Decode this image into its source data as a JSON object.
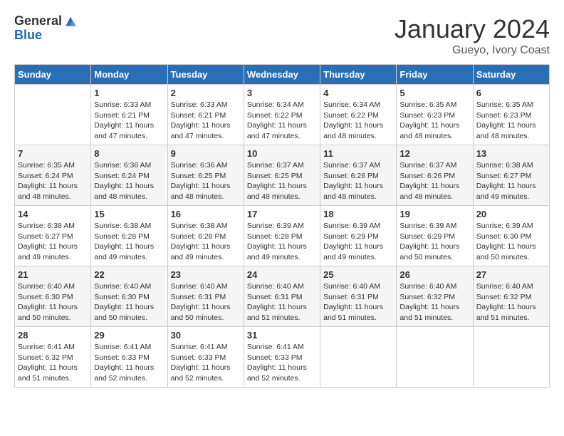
{
  "logo": {
    "general": "General",
    "blue": "Blue"
  },
  "title": {
    "month_year": "January 2024",
    "location": "Gueyo, Ivory Coast"
  },
  "days_of_week": [
    "Sunday",
    "Monday",
    "Tuesday",
    "Wednesday",
    "Thursday",
    "Friday",
    "Saturday"
  ],
  "weeks": [
    [
      {
        "day": "",
        "sunrise": "",
        "sunset": "",
        "daylight": ""
      },
      {
        "day": "1",
        "sunrise": "Sunrise: 6:33 AM",
        "sunset": "Sunset: 6:21 PM",
        "daylight": "Daylight: 11 hours and 47 minutes."
      },
      {
        "day": "2",
        "sunrise": "Sunrise: 6:33 AM",
        "sunset": "Sunset: 6:21 PM",
        "daylight": "Daylight: 11 hours and 47 minutes."
      },
      {
        "day": "3",
        "sunrise": "Sunrise: 6:34 AM",
        "sunset": "Sunset: 6:22 PM",
        "daylight": "Daylight: 11 hours and 47 minutes."
      },
      {
        "day": "4",
        "sunrise": "Sunrise: 6:34 AM",
        "sunset": "Sunset: 6:22 PM",
        "daylight": "Daylight: 11 hours and 48 minutes."
      },
      {
        "day": "5",
        "sunrise": "Sunrise: 6:35 AM",
        "sunset": "Sunset: 6:23 PM",
        "daylight": "Daylight: 11 hours and 48 minutes."
      },
      {
        "day": "6",
        "sunrise": "Sunrise: 6:35 AM",
        "sunset": "Sunset: 6:23 PM",
        "daylight": "Daylight: 11 hours and 48 minutes."
      }
    ],
    [
      {
        "day": "7",
        "sunrise": "Sunrise: 6:35 AM",
        "sunset": "Sunset: 6:24 PM",
        "daylight": "Daylight: 11 hours and 48 minutes."
      },
      {
        "day": "8",
        "sunrise": "Sunrise: 6:36 AM",
        "sunset": "Sunset: 6:24 PM",
        "daylight": "Daylight: 11 hours and 48 minutes."
      },
      {
        "day": "9",
        "sunrise": "Sunrise: 6:36 AM",
        "sunset": "Sunset: 6:25 PM",
        "daylight": "Daylight: 11 hours and 48 minutes."
      },
      {
        "day": "10",
        "sunrise": "Sunrise: 6:37 AM",
        "sunset": "Sunset: 6:25 PM",
        "daylight": "Daylight: 11 hours and 48 minutes."
      },
      {
        "day": "11",
        "sunrise": "Sunrise: 6:37 AM",
        "sunset": "Sunset: 6:26 PM",
        "daylight": "Daylight: 11 hours and 48 minutes."
      },
      {
        "day": "12",
        "sunrise": "Sunrise: 6:37 AM",
        "sunset": "Sunset: 6:26 PM",
        "daylight": "Daylight: 11 hours and 48 minutes."
      },
      {
        "day": "13",
        "sunrise": "Sunrise: 6:38 AM",
        "sunset": "Sunset: 6:27 PM",
        "daylight": "Daylight: 11 hours and 49 minutes."
      }
    ],
    [
      {
        "day": "14",
        "sunrise": "Sunrise: 6:38 AM",
        "sunset": "Sunset: 6:27 PM",
        "daylight": "Daylight: 11 hours and 49 minutes."
      },
      {
        "day": "15",
        "sunrise": "Sunrise: 6:38 AM",
        "sunset": "Sunset: 6:28 PM",
        "daylight": "Daylight: 11 hours and 49 minutes."
      },
      {
        "day": "16",
        "sunrise": "Sunrise: 6:38 AM",
        "sunset": "Sunset: 6:28 PM",
        "daylight": "Daylight: 11 hours and 49 minutes."
      },
      {
        "day": "17",
        "sunrise": "Sunrise: 6:39 AM",
        "sunset": "Sunset: 6:28 PM",
        "daylight": "Daylight: 11 hours and 49 minutes."
      },
      {
        "day": "18",
        "sunrise": "Sunrise: 6:39 AM",
        "sunset": "Sunset: 6:29 PM",
        "daylight": "Daylight: 11 hours and 49 minutes."
      },
      {
        "day": "19",
        "sunrise": "Sunrise: 6:39 AM",
        "sunset": "Sunset: 6:29 PM",
        "daylight": "Daylight: 11 hours and 50 minutes."
      },
      {
        "day": "20",
        "sunrise": "Sunrise: 6:39 AM",
        "sunset": "Sunset: 6:30 PM",
        "daylight": "Daylight: 11 hours and 50 minutes."
      }
    ],
    [
      {
        "day": "21",
        "sunrise": "Sunrise: 6:40 AM",
        "sunset": "Sunset: 6:30 PM",
        "daylight": "Daylight: 11 hours and 50 minutes."
      },
      {
        "day": "22",
        "sunrise": "Sunrise: 6:40 AM",
        "sunset": "Sunset: 6:30 PM",
        "daylight": "Daylight: 11 hours and 50 minutes."
      },
      {
        "day": "23",
        "sunrise": "Sunrise: 6:40 AM",
        "sunset": "Sunset: 6:31 PM",
        "daylight": "Daylight: 11 hours and 50 minutes."
      },
      {
        "day": "24",
        "sunrise": "Sunrise: 6:40 AM",
        "sunset": "Sunset: 6:31 PM",
        "daylight": "Daylight: 11 hours and 51 minutes."
      },
      {
        "day": "25",
        "sunrise": "Sunrise: 6:40 AM",
        "sunset": "Sunset: 6:31 PM",
        "daylight": "Daylight: 11 hours and 51 minutes."
      },
      {
        "day": "26",
        "sunrise": "Sunrise: 6:40 AM",
        "sunset": "Sunset: 6:32 PM",
        "daylight": "Daylight: 11 hours and 51 minutes."
      },
      {
        "day": "27",
        "sunrise": "Sunrise: 6:40 AM",
        "sunset": "Sunset: 6:32 PM",
        "daylight": "Daylight: 11 hours and 51 minutes."
      }
    ],
    [
      {
        "day": "28",
        "sunrise": "Sunrise: 6:41 AM",
        "sunset": "Sunset: 6:32 PM",
        "daylight": "Daylight: 11 hours and 51 minutes."
      },
      {
        "day": "29",
        "sunrise": "Sunrise: 6:41 AM",
        "sunset": "Sunset: 6:33 PM",
        "daylight": "Daylight: 11 hours and 52 minutes."
      },
      {
        "day": "30",
        "sunrise": "Sunrise: 6:41 AM",
        "sunset": "Sunset: 6:33 PM",
        "daylight": "Daylight: 11 hours and 52 minutes."
      },
      {
        "day": "31",
        "sunrise": "Sunrise: 6:41 AM",
        "sunset": "Sunset: 6:33 PM",
        "daylight": "Daylight: 11 hours and 52 minutes."
      },
      {
        "day": "",
        "sunrise": "",
        "sunset": "",
        "daylight": ""
      },
      {
        "day": "",
        "sunrise": "",
        "sunset": "",
        "daylight": ""
      },
      {
        "day": "",
        "sunrise": "",
        "sunset": "",
        "daylight": ""
      }
    ]
  ]
}
